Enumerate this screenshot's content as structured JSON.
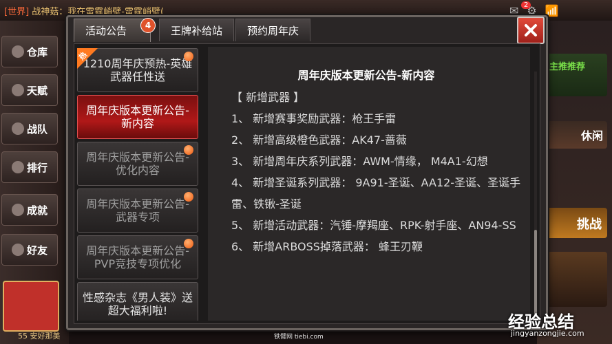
{
  "background": {
    "chat_tag": "[世界]",
    "chat_text": "战神菇：我在雷霆峭壁-雷霆峭壁(",
    "side_buttons": [
      "仓库",
      "天赋",
      "战队",
      "排行",
      "成就",
      "好友"
    ],
    "level_text": "55 安好那美",
    "notification_count": "2",
    "right_banners": [
      "主推推荐",
      "休闲",
      "挑战"
    ]
  },
  "dialog": {
    "tabs": [
      {
        "label": "活动公告",
        "badge": "4"
      },
      {
        "label": "王牌补给站"
      },
      {
        "label": "预约周年庆"
      }
    ],
    "announcements": [
      {
        "title": "1210周年庆预热-英雄武器任性送",
        "hot": "热",
        "dot": true
      },
      {
        "title": "周年庆版本更新公告-新内容",
        "active": true
      },
      {
        "title": "周年庆版本更新公告-优化内容",
        "dot": true
      },
      {
        "title": "周年庆版本更新公告-武器专项",
        "dot": true
      },
      {
        "title": "周年庆版本更新公告-PVP竞技专项优化",
        "dot": true
      },
      {
        "title": "性感杂志《男人装》送超大福利啦!"
      }
    ],
    "content": {
      "title": "周年庆版本更新公告-新内容",
      "section": "【 新增武器 】",
      "lines": [
        "1、 新增赛事奖励武器：枪王手雷",
        "2、 新增高级橙色武器：AK47-蔷薇",
        "3、 新增周年庆系列武器：AWM-情缘， M4A1-幻想",
        "4、 新增圣诞系列武器： 9A91-圣诞、AA12-圣诞、圣诞手雷、铁锹-圣诞",
        "5、 新增活动武器：汽锤-摩羯座、RPK-射手座、AN94-SS",
        "6、 新增ARBOSS掉落武器： 蜂王刃鞭"
      ]
    }
  },
  "watermarks": {
    "brand": "经验总结",
    "url": "jingyanzongjie.com",
    "small": "铁臂网 tiebi.com"
  },
  "colors": {
    "accent_red": "#b01818",
    "badge_orange": "#e0522b",
    "dot_orange": "#f05a10"
  }
}
